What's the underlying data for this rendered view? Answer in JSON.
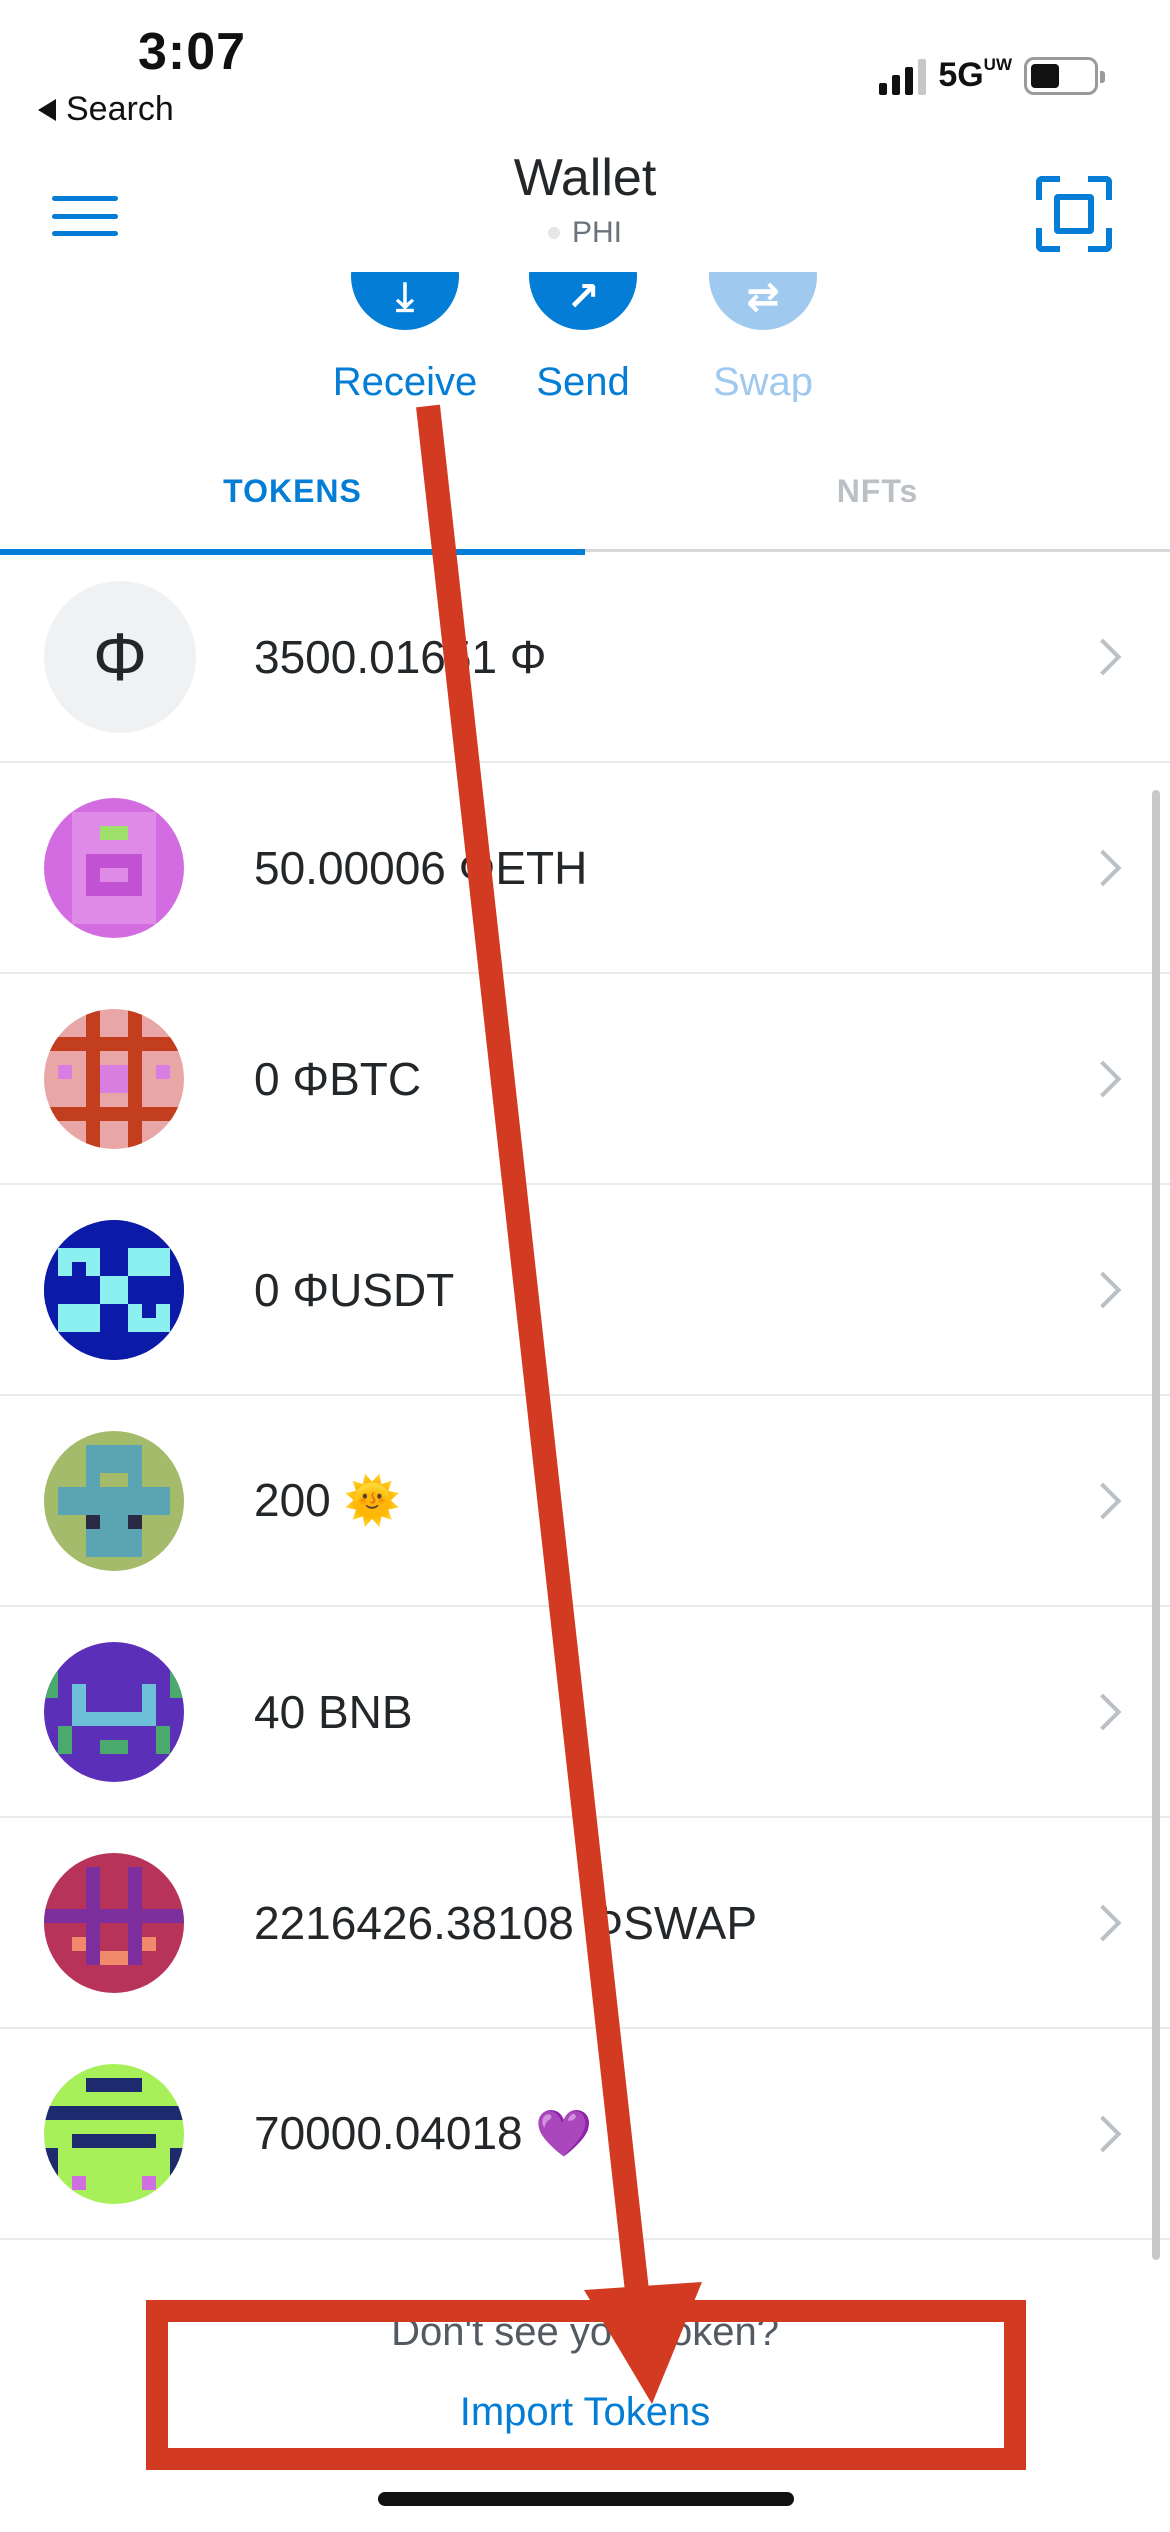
{
  "status_bar": {
    "time": "3:07",
    "back_label": "Search",
    "network": "5G",
    "network_sup": "UW"
  },
  "header": {
    "title": "Wallet",
    "network_name": "PHI"
  },
  "actions": [
    {
      "label": "Receive",
      "icon": "download-icon",
      "enabled": true
    },
    {
      "label": "Send",
      "icon": "arrow-up-right-icon",
      "enabled": true
    },
    {
      "label": "Swap",
      "icon": "swap-icon",
      "enabled": false
    }
  ],
  "tabs": [
    {
      "label": "TOKENS",
      "active": true
    },
    {
      "label": "NFTs",
      "active": false
    }
  ],
  "tokens": [
    {
      "balance": "3500.01651 Φ",
      "icon": "phi-symbol",
      "icon_text": "Φ"
    },
    {
      "balance": "50.00006 ΦETH",
      "icon": "identicon-magenta"
    },
    {
      "balance": "0 ΦBTC",
      "icon": "identicon-red-pink"
    },
    {
      "balance": "0 ΦUSDT",
      "icon": "identicon-blue-cyan"
    },
    {
      "balance": "200 🌞",
      "icon": "identicon-olive-teal"
    },
    {
      "balance": "40 BNB",
      "icon": "identicon-purple-green"
    },
    {
      "balance": "2216426.38108 ΦSWAP",
      "icon": "identicon-crimson-purple"
    },
    {
      "balance": "70000.04018 💜",
      "icon": "identicon-lime-navy"
    }
  ],
  "footer": {
    "question": "Don't see your token?",
    "import_link": "Import Tokens"
  },
  "colors": {
    "accent": "#037dd6",
    "annotation": "#d33a22"
  }
}
